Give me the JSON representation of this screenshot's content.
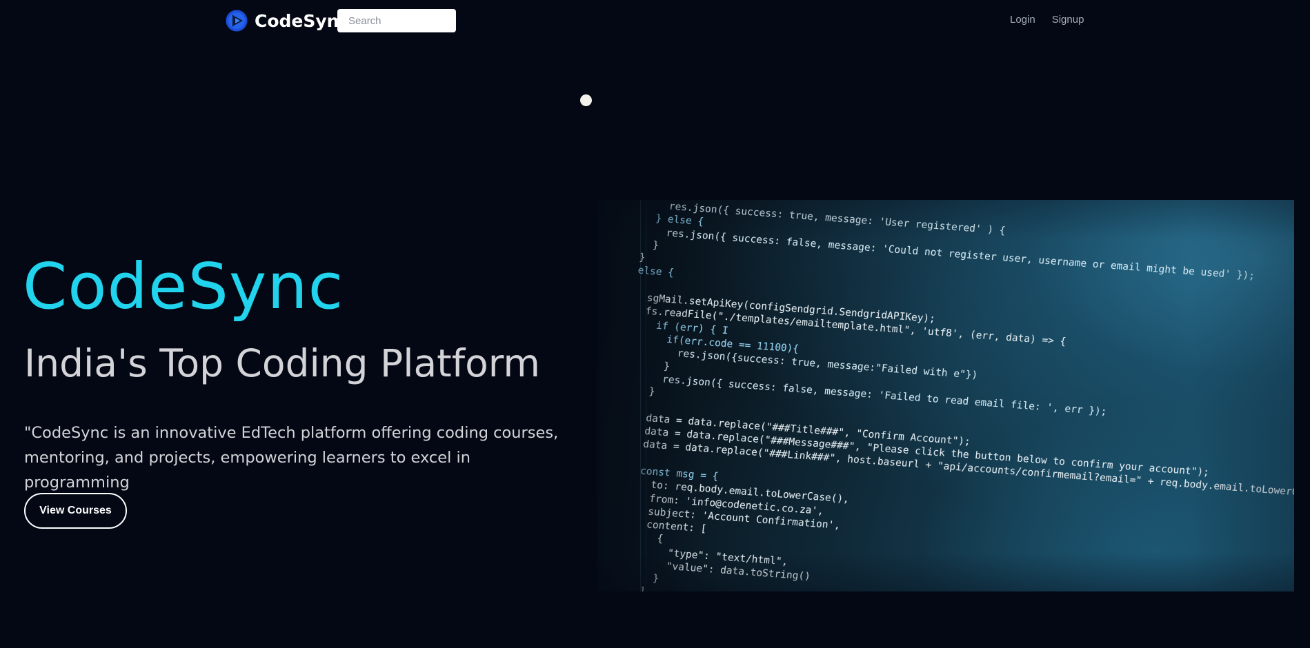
{
  "navbar": {
    "brand_name": "CodeSync",
    "brand_icon": "play-circle-logo-icon",
    "search_placeholder": "Search",
    "links": {
      "login": "Login",
      "signup": "Signup"
    }
  },
  "hero": {
    "title": "CodeSync",
    "subtitle": "India's Top Coding Platform",
    "description": "\"CodeSync is an innovative EdTech platform offering coding courses, mentoring, and projects, empowering learners to excel in programming",
    "cta_label": "View Courses"
  },
  "code_image": {
    "lines": [
      "    res.json({ success: true, message: 'User registered' ) {",
      "  } else {",
      "    res.json({ success: false, message: 'Could not register user, username or email might be used' });",
      "  }",
      "}",
      "else {",
      "",
      "  sgMail.setApiKey(configSendgrid.SendgridAPIKey);",
      "  fs.readFile(\"./templates/emailtemplate.html\", 'utf8', (err, data) => {",
      "    if (err) { I",
      "      if(err.code == 11100){",
      "        res.json({success: true, message:\"Failed with e\"})",
      "      }",
      "      res.json({ success: false, message: 'Failed to read email file: ', err });",
      "    }",
      "",
      "    data = data.replace(\"###Title###\", \"Confirm Account\");",
      "    data = data.replace(\"###Message###\", \"Please click the button below to confirm your account\");",
      "    data = data.replace(\"###Link###\", host.baseurl + \"api/accounts/confirmemail?email=\" + req.body.email.toLowerCase());",
      "",
      "    const msg = {",
      "      to: req.body.email.toLowerCase(),",
      "      from: 'info@codenetic.co.za',",
      "      subject: 'Account Confirmation',",
      "      content: [",
      "        {",
      "          \"type\": \"text/html\",",
      "          \"value\": data.toString()",
      "        }",
      "      ]"
    ]
  },
  "colors": {
    "background": "#030814",
    "accent": "#22d3ee",
    "text_light": "#d4d4d8",
    "nav_link": "#a9afba"
  }
}
